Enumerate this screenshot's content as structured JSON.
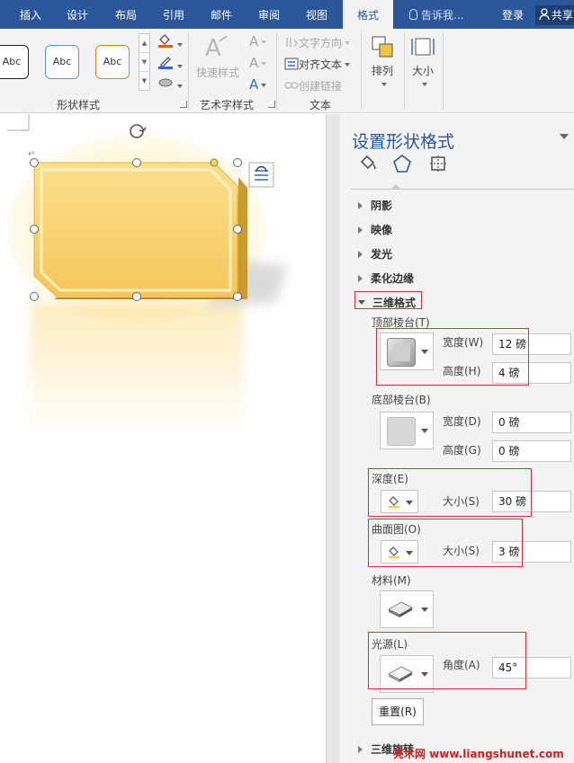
{
  "ribbon": {
    "tabs": [
      "插入",
      "设计",
      "布局",
      "引用",
      "邮件",
      "审阅",
      "视图",
      "格式"
    ],
    "active_tab": "格式",
    "tell_me": "告诉我...",
    "login": "登录",
    "share": "共享",
    "shape_styles": {
      "items": [
        "Abc",
        "Abc",
        "Abc"
      ],
      "label": "形状样式"
    },
    "wordart": {
      "quick_styles": "快速样式",
      "label": "艺术字样式"
    },
    "text_group": {
      "direction": "文字方向",
      "align": "对齐文本",
      "link": "创建链接",
      "label": "文本"
    },
    "arrange": "排列",
    "size": "大小"
  },
  "pane": {
    "title": "设置形状格式",
    "sections": {
      "shadow": "阴影",
      "reflection": "映像",
      "glow": "发光",
      "soft_edges": "柔化边缘",
      "three_d_format": "三维格式",
      "three_d_rotation": "三维旋转"
    },
    "top_bevel": {
      "label": "顶部棱台(T)",
      "width_label": "宽度(W)",
      "width": "12 磅",
      "height_label": "高度(H)",
      "height": "4 磅"
    },
    "bottom_bevel": {
      "label": "底部棱台(B)",
      "width_label": "宽度(D)",
      "width": "0 磅",
      "height_label": "高度(G)",
      "height": "0 磅"
    },
    "depth": {
      "label": "深度(E)",
      "size_label": "大小(S)",
      "size": "30 磅"
    },
    "contour": {
      "label": "曲面图(O)",
      "size_label": "大小(S)",
      "size": "3 磅"
    },
    "material": {
      "label": "材料(M)"
    },
    "lighting": {
      "label": "光源(L)",
      "angle_label": "角度(A)",
      "angle": "45°"
    },
    "reset": "重置(R)"
  },
  "watermark": "亮术网 www.liangshunet.com",
  "colors": {
    "accent": "#2b579a",
    "shape_fill": "#fbd875",
    "highlight": "#e03030"
  }
}
